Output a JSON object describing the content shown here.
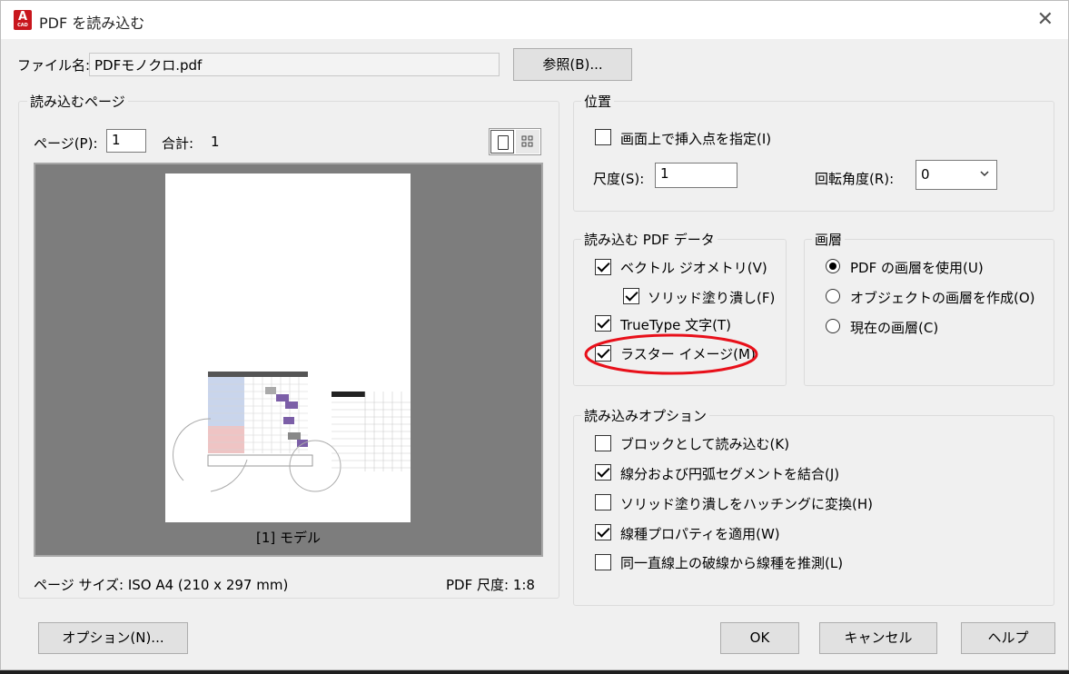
{
  "window": {
    "title": "PDF を読み込む",
    "icon_text": "A",
    "icon_sub": "CAD"
  },
  "file": {
    "label": "ファイル名:",
    "value": "PDFモノクロ.pdf",
    "browse_label": "参照(B)..."
  },
  "pages": {
    "group_label": "読み込むページ",
    "page_label": "ページ(P):",
    "page_value": "1",
    "total_label": "合計:",
    "total_value": "1",
    "preview_caption": "[1] モデル",
    "page_size": "ページ サイズ: ISO A4 (210 x 297 mm)",
    "pdf_scale": "PDF 尺度: 1:8"
  },
  "position": {
    "group_label": "位置",
    "specify_label": "画面上で挿入点を指定(I)",
    "specify_checked": false,
    "scale_label": "尺度(S):",
    "scale_value": "1",
    "rotation_label": "回転角度(R):",
    "rotation_value": "0"
  },
  "pdf_data": {
    "group_label": "読み込む PDF データ",
    "items": [
      {
        "label": "ベクトル ジオメトリ(V)",
        "checked": true
      },
      {
        "label": "ソリッド塗り潰し(F)",
        "checked": true
      },
      {
        "label": "TrueType 文字(T)",
        "checked": true
      },
      {
        "label": "ラスター イメージ(M)",
        "checked": true
      }
    ]
  },
  "layers": {
    "group_label": "画層",
    "options": [
      {
        "label": "PDF の画層を使用(U)",
        "selected": true
      },
      {
        "label": "オブジェクトの画層を作成(O)",
        "selected": false
      },
      {
        "label": "現在の画層(C)",
        "selected": false
      }
    ]
  },
  "import_options": {
    "group_label": "読み込みオプション",
    "items": [
      {
        "label": "ブロックとして読み込む(K)",
        "checked": false
      },
      {
        "label": "線分および円弧セグメントを結合(J)",
        "checked": true
      },
      {
        "label": "ソリッド塗り潰しをハッチングに変換(H)",
        "checked": false
      },
      {
        "label": "線種プロパティを適用(W)",
        "checked": true
      },
      {
        "label": "同一直線上の破線から線種を推測(L)",
        "checked": false
      }
    ]
  },
  "buttons": {
    "options": "オプション(N)...",
    "ok": "OK",
    "cancel": "キャンセル",
    "help": "ヘルプ"
  },
  "colors": {
    "annotation": "#e8101a",
    "accent_purple": "#7b5ea7"
  }
}
